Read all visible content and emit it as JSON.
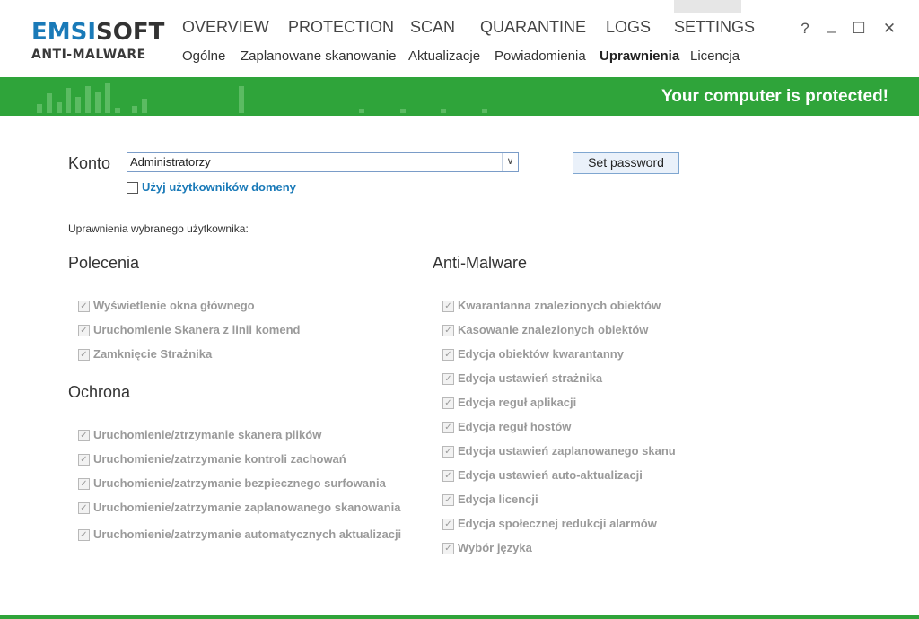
{
  "app": {
    "brand_part1": "EMSI",
    "brand_part2": "SOFT",
    "product": "ANTI-MALWARE"
  },
  "main_nav": [
    "OVERVIEW",
    "PROTECTION",
    "SCAN",
    "QUARANTINE",
    "LOGS",
    "SETTINGS"
  ],
  "sub_nav": [
    "Ogólne",
    "Zaplanowane skanowanie",
    "Aktualizacje",
    "Powiadomienia",
    "Uprawnienia",
    "Licencja"
  ],
  "sub_nav_active": "Uprawnienia",
  "window_controls": {
    "help": "?",
    "minimize": "_",
    "maximize": "☐",
    "close": "✕"
  },
  "status_banner": {
    "message": "Your computer is protected!",
    "color": "#2fa43a"
  },
  "account": {
    "label": "Konto",
    "selected": "Administratorzy",
    "set_password_label": "Set password",
    "domain_users_label": "Użyj użytkowników domeny",
    "domain_users_checked": false
  },
  "permissions_caption": "Uprawnienia wybranego użytkownika:",
  "sections": {
    "commands": {
      "title": "Polecenia",
      "items": [
        "Wyświetlenie okna głównego",
        "Uruchomienie Skanera z linii komend",
        "Zamknięcie Strażnika"
      ]
    },
    "protection": {
      "title": "Ochrona",
      "items": [
        "Uruchomienie/ztrzymanie skanera plików",
        "Uruchomienie/zatrzymanie kontroli zachowań",
        "Uruchomienie/zatrzymanie bezpiecznego surfowania",
        "Uruchomienie/zatrzymanie zaplanowanego skanowania",
        "Uruchomienie/zatrzymanie automatycznych aktualizacji"
      ]
    },
    "antimalware": {
      "title": "Anti-Malware",
      "items": [
        "Kwarantanna znalezionych obiektów",
        "Kasowanie znalezionych obiektów",
        "Edycja obiektów kwarantanny",
        "Edycja ustawień strażnika",
        "Edycja reguł aplikacji",
        "Edycja reguł hostów",
        "Edycja ustawień zaplanowanego skanu",
        "Edycja ustawień auto-aktualizacji",
        "Edycja licencji",
        "Edycja społecznej redukcji alarmów",
        "Wybór języka"
      ]
    }
  }
}
